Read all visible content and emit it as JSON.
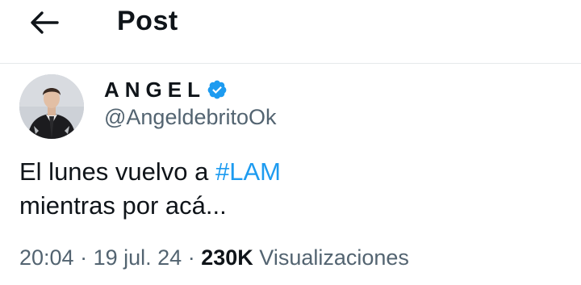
{
  "header": {
    "back_icon": "arrow-left-icon",
    "title": "Post"
  },
  "author": {
    "display_name": "ANGEL",
    "verified_icon": "verified-badge-icon",
    "verified_color": "#1d9bf0",
    "handle": "@AngeldebritoOk"
  },
  "post": {
    "text_line1_prefix": "El lunes vuelvo a ",
    "hashtag": "#LAM",
    "text_line2": "mientras por acá...",
    "time": "20:04",
    "date": "19 jul. 24",
    "separator": "·",
    "views_count": "230K",
    "views_label": "Visualizaciones"
  },
  "colors": {
    "link": "#1d9bf0",
    "secondary_text": "#536471",
    "primary_text": "#0f1419"
  }
}
